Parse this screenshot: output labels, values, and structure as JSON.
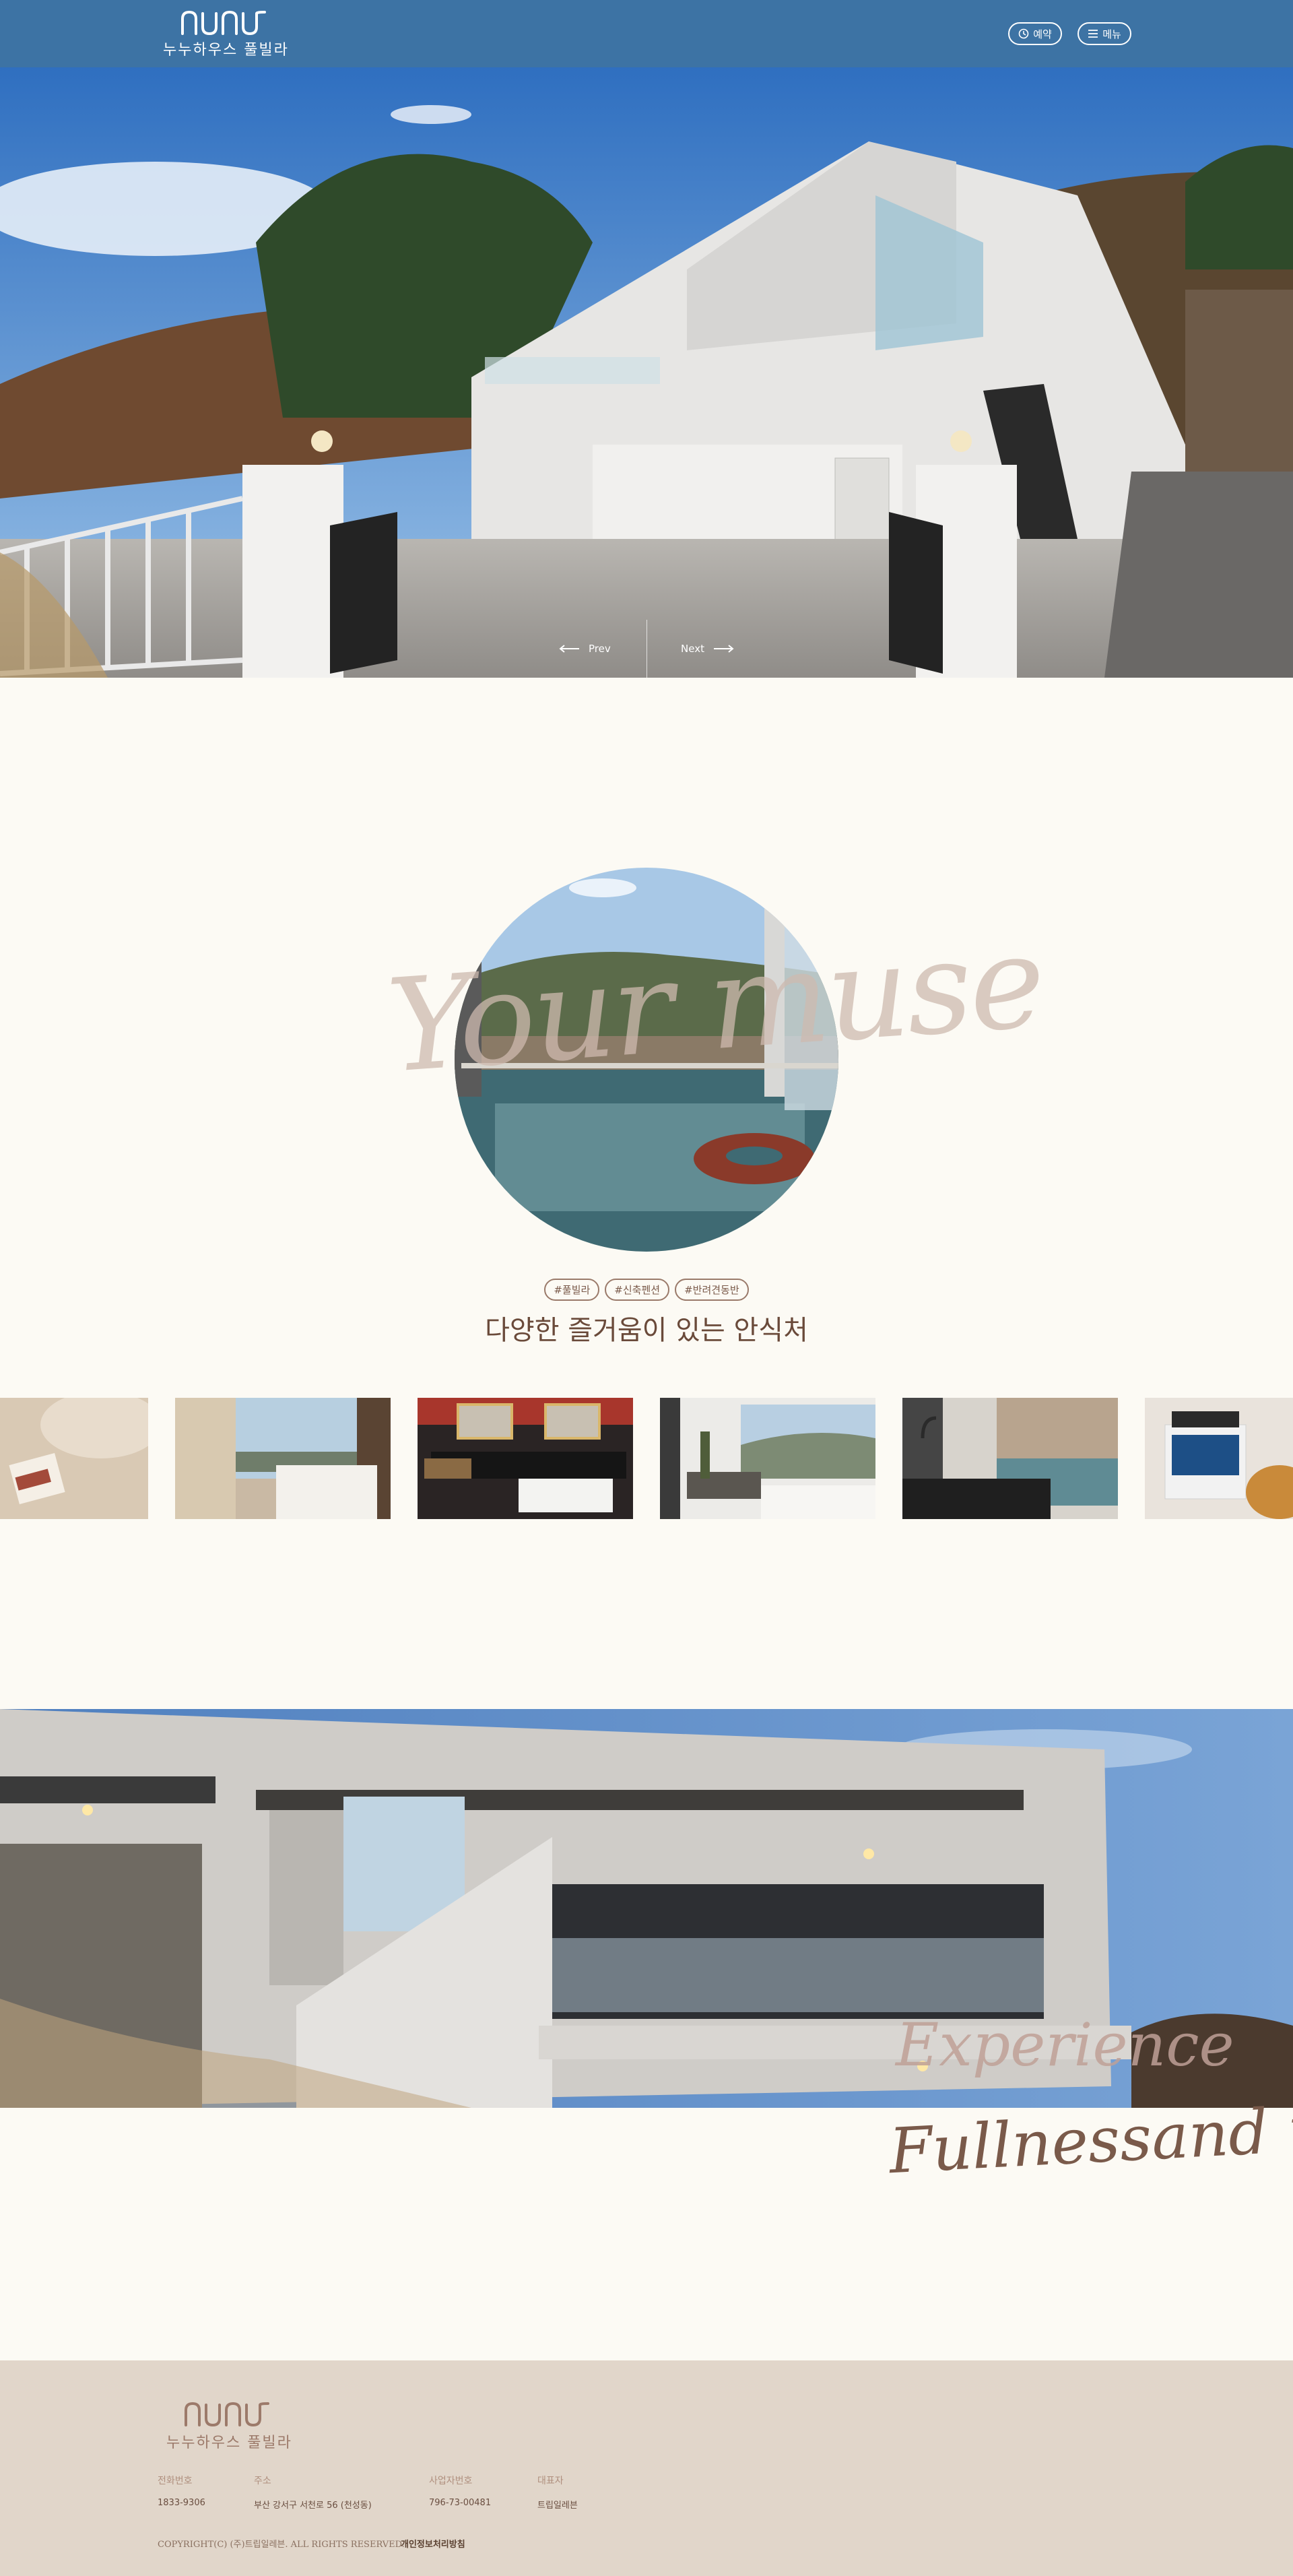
{
  "header": {
    "brand_name": "누누하우스 풀빌라",
    "reserve_label": "예약",
    "menu_label": "메뉴"
  },
  "hero": {
    "prev_label": "Prev",
    "next_label": "Next"
  },
  "muse": {
    "script_text": "Your muse",
    "tags": [
      "#풀빌라",
      "#신축펜션",
      "#반려견동반"
    ],
    "title": "다양한 즐거움이 있는 안식처"
  },
  "experience": {
    "script_line_1": "Experience",
    "script_line_2": "Fullnessand rest"
  },
  "footer": {
    "brand_name": "누누하우스 풀빌라",
    "phone_label": "전화번호",
    "phone_value": "1833-9306",
    "address_label": "주소",
    "address_value": "부산 강서구 서천로 56 (천성동)",
    "biz_label": "사업자번호",
    "biz_value": "796-73-00481",
    "ceo_label": "대표자",
    "ceo_value": "트립일레븐",
    "copyright": "COPYRIGHT(C) (주)트립일레븐. ALL RIGHTS RESERVED.",
    "privacy_label": "개인정보처리방침"
  },
  "colors": {
    "header_bg": "#3d73a4",
    "page_bg": "#fcfaf4",
    "footer_bg": "#e1d6ca",
    "accent_brown": "#6a4a3a"
  }
}
